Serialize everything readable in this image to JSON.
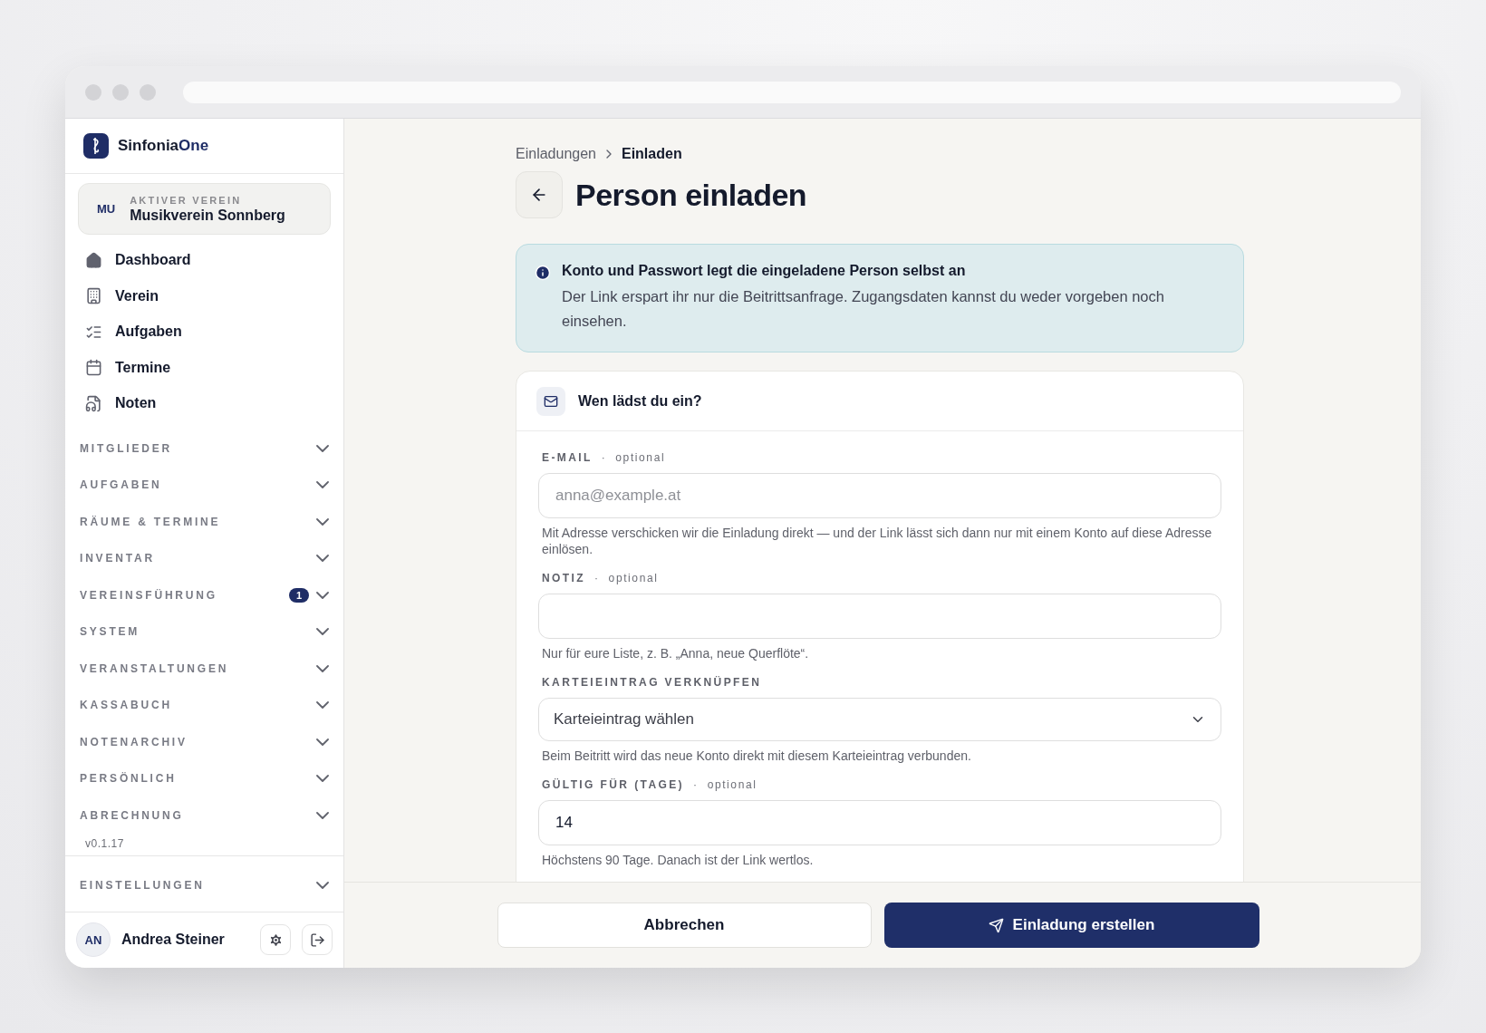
{
  "app": {
    "brand_main": "Sinfonia",
    "brand_accent": "One"
  },
  "active_club": {
    "initials": "MU",
    "caption": "AKTIVER VEREIN",
    "name": "Musikverein Sonnberg"
  },
  "nav": [
    {
      "label": "Dashboard"
    },
    {
      "label": "Verein"
    },
    {
      "label": "Aufgaben"
    },
    {
      "label": "Termine"
    },
    {
      "label": "Noten"
    }
  ],
  "sections": [
    {
      "label": "MITGLIEDER",
      "expanded": false
    },
    {
      "label": "AUFGABEN",
      "expanded": false
    },
    {
      "label": "RÄUME & TERMINE",
      "expanded": false
    },
    {
      "label": "INVENTAR",
      "expanded": false
    },
    {
      "label": "VEREINSFÜHRUNG",
      "expanded": false,
      "badge": "1"
    },
    {
      "label": "SYSTEM",
      "expanded": false
    },
    {
      "label": "VERANSTALTUNGEN",
      "expanded": false
    },
    {
      "label": "KASSABUCH",
      "expanded": false
    },
    {
      "label": "NOTENARCHIV",
      "expanded": false
    },
    {
      "label": "PERSÖNLICH",
      "expanded": false
    },
    {
      "label": "ABRECHNUNG",
      "expanded": false
    }
  ],
  "version": "v0.1.17",
  "settings_section": {
    "label": "EINSTELLUNGEN",
    "expanded": false
  },
  "user": {
    "initials": "AN",
    "name": "Andrea Steiner"
  },
  "breadcrumb": [
    {
      "label": "Einladungen",
      "current": false
    },
    {
      "label": "Einladen",
      "current": true
    }
  ],
  "page_title": "Person einladen",
  "info": {
    "title": "Konto und Passwort legt die eingeladene Person selbst an",
    "text": "Der Link erspart ihr nur die Beitrittsanfrage. Zugangsdaten kannst du weder vorgeben noch einsehen."
  },
  "card_title": "Wen lädst du ein?",
  "fields": [
    {
      "kind": "input",
      "label": "E-MAIL",
      "separator": "·",
      "optional": "optional",
      "placeholder": "anna@example.at",
      "help": "Mit Adresse verschicken wir die Einladung direkt — und der Link lässt sich dann nur mit einem Konto auf diese Adresse einlösen."
    },
    {
      "kind": "input",
      "label": "NOTIZ",
      "separator": "·",
      "optional": "optional",
      "help": "Nur für eure Liste, z. B. „Anna, neue Querflöte“."
    },
    {
      "kind": "select",
      "label": "KARTEIEINTRAG VERKNÜPFEN",
      "value": "Karteieintrag wählen",
      "help": "Beim Beitritt wird das neue Konto direkt mit diesem Karteieintrag verbunden."
    },
    {
      "kind": "input",
      "label": "GÜLTIG FÜR (TAGE)",
      "separator": "·",
      "optional": "optional",
      "value": "14",
      "help": "Höchstens 90 Tage. Danach ist der Link wertlos."
    }
  ],
  "actions": {
    "cancel": "Abbrechen",
    "submit": "Einladung erstellen"
  }
}
